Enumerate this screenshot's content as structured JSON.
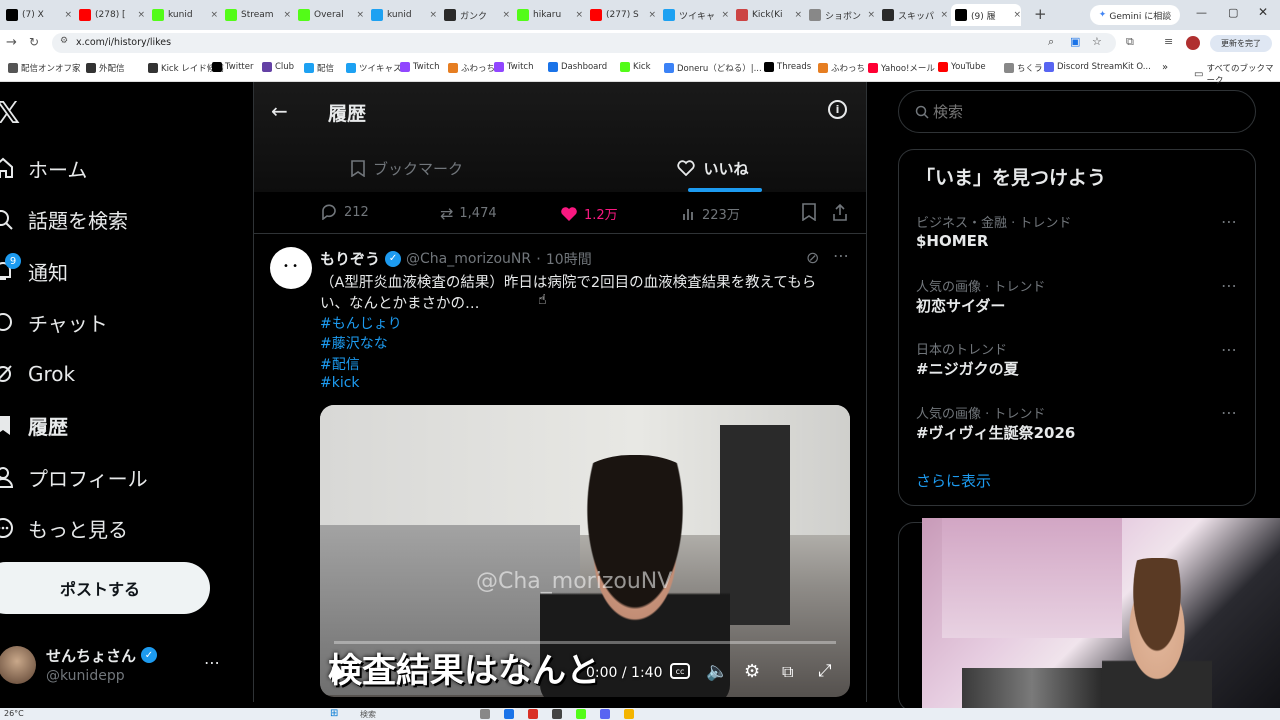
{
  "browser": {
    "tabs": [
      {
        "label": "(7) X",
        "color": "#000000"
      },
      {
        "label": "(278) [",
        "color": "#ff0000"
      },
      {
        "label": "kunid",
        "color": "#53fc18"
      },
      {
        "label": "Stream",
        "color": "#53fc18"
      },
      {
        "label": "Overal",
        "color": "#53fc18"
      },
      {
        "label": "kunid",
        "color": "#1da1f2"
      },
      {
        "label": "ガンク",
        "color": "#2a2a2a"
      },
      {
        "label": "hikaru",
        "color": "#53fc18"
      },
      {
        "label": "(277) S",
        "color": "#ff0000"
      },
      {
        "label": "ツイキャ",
        "color": "#1da1f2"
      },
      {
        "label": "Kick(Ki",
        "color": "#cc4444"
      },
      {
        "label": "ショボン",
        "color": "#888888"
      },
      {
        "label": "スキッパ",
        "color": "#2a2a2a"
      },
      {
        "label": "(9) 履",
        "color": "#000000"
      }
    ],
    "gemini_button": "Gemini に相談",
    "url": "x.com/i/history/likes",
    "update_button": "更新を完了",
    "bookmarks": [
      "配信オンオフ家",
      "外配信",
      "Kick レイド候補",
      "Twitter",
      "Club",
      "配信",
      "ツイキャス",
      "Twitch",
      "ふわっち",
      "Twitch",
      "Dashboard",
      "Kick",
      "Doneru（どねる）|...",
      "Threads",
      "ふわっち",
      "Yahoo!メール",
      "YouTube",
      "ちくラン",
      "Discord StreamKit O..."
    ],
    "all_bookmarks": "すべてのブックマーク"
  },
  "nav": {
    "items": [
      "ホーム",
      "話題を検索",
      "通知",
      "チャット",
      "Grok",
      "履歴",
      "プロフィール",
      "もっと見る"
    ],
    "notif_badge": "9",
    "post_button": "ポストする",
    "user_name": "せんちょさん",
    "user_handle": "@kunidepp"
  },
  "header": {
    "title": "履歴",
    "tabs": [
      "ブックマーク",
      "いいね"
    ],
    "active_tab": "いいね"
  },
  "action_bar": {
    "replies": "212",
    "reposts": "1,474",
    "likes": "1.2万",
    "views": "223万"
  },
  "tweet": {
    "name": "もりぞう",
    "handle": "@Cha_morizouNR",
    "time": "10時間",
    "text_line1": "（A型肝炎血液検査の結果）昨日は病院で2回目の血液検査結果を教えてもら",
    "text_line2": "い、なんとかまさかの…",
    "hashtags": [
      "#もんじょり",
      "#藤沢なな",
      "#配信",
      "#kick"
    ],
    "video": {
      "watermark": "@Cha_morizouNV",
      "caption": "検査結果はなんと",
      "time": "0:00 / 1:40",
      "progress": 0
    }
  },
  "sidebar": {
    "search_placeholder": "検索",
    "trends_title": "「いま」を見つけよう",
    "trends": [
      {
        "category": "ビジネス・金融 · トレンド",
        "name": "$HOMER"
      },
      {
        "category": "人気の画像 · トレンド",
        "name": "初恋サイダー"
      },
      {
        "category": "日本のトレンド",
        "name": "#ニジガクの夏"
      },
      {
        "category": "人気の画像 · トレンド",
        "name": "#ヴィヴィ生誕祭2026"
      }
    ],
    "show_more": "さらに表示"
  },
  "taskbar": {
    "temp": "26°C",
    "search": "検索"
  }
}
